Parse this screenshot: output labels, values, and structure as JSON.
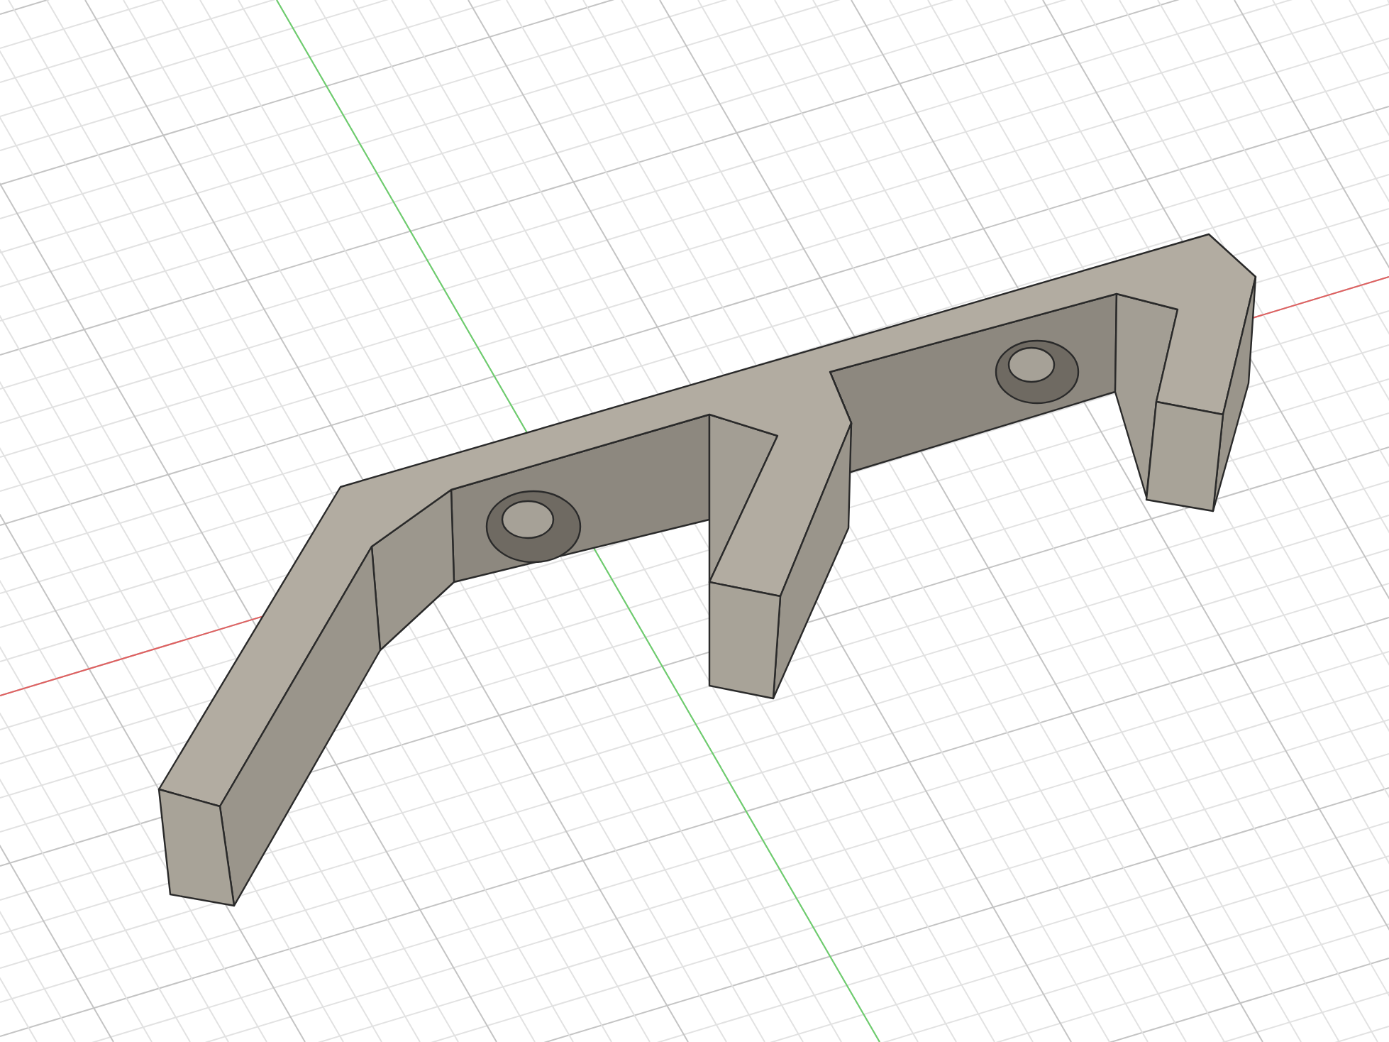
{
  "viewport": {
    "grid_visible": true,
    "axis_lines_visible": true
  }
}
